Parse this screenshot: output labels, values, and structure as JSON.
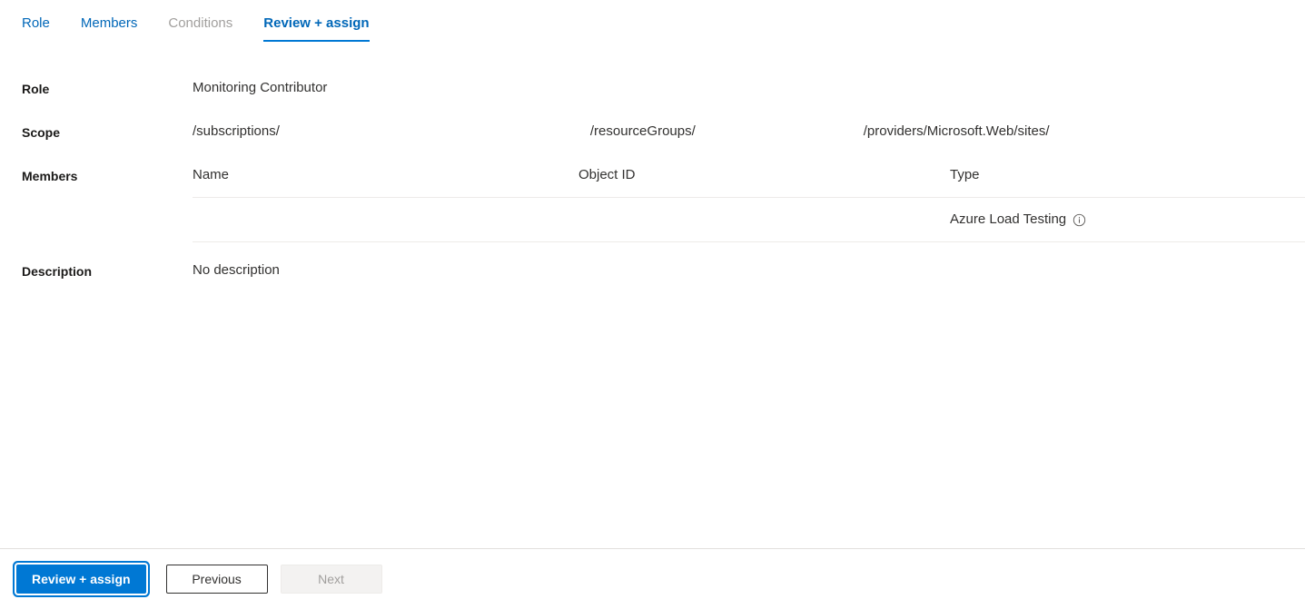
{
  "tabs": [
    {
      "label": "Role",
      "state": "enabled"
    },
    {
      "label": "Members",
      "state": "enabled"
    },
    {
      "label": "Conditions",
      "state": "disabled"
    },
    {
      "label": "Review + assign",
      "state": "active"
    }
  ],
  "summary": {
    "role": {
      "label": "Role",
      "value": "Monitoring Contributor"
    },
    "scope": {
      "label": "Scope",
      "segments": [
        "/subscriptions/",
        "/resourceGroups/",
        "/providers/Microsoft.Web/sites/"
      ]
    },
    "members": {
      "label": "Members",
      "columns": [
        "Name",
        "Object ID",
        "Type"
      ],
      "rows": [
        {
          "name": "",
          "object_id": "",
          "type": "Azure Load Testing",
          "info_icon": "info-circle-icon"
        }
      ]
    },
    "description": {
      "label": "Description",
      "value": "No description"
    }
  },
  "footer": {
    "primary_button": "Review + assign",
    "previous_button": "Previous",
    "next_button": "Next"
  },
  "colors": {
    "accent": "#0078d4",
    "link": "#0067b8",
    "disabled_text": "#a19f9d",
    "text": "#323130",
    "divider": "#e1dfdd",
    "table_rule": "#edebe9"
  }
}
